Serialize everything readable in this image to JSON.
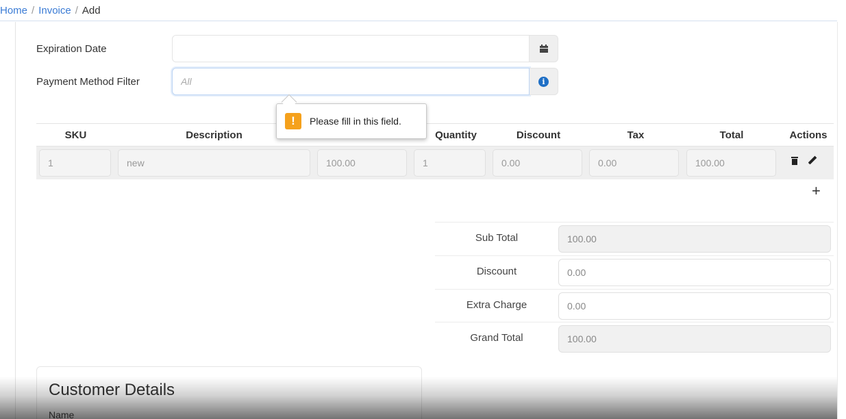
{
  "breadcrumb": {
    "home": "Home",
    "sep": "/",
    "invoice": "Invoice",
    "current": "Add"
  },
  "form": {
    "expiration_label": "Expiration Date",
    "expiration_value": "",
    "payment_label": "Payment Method Filter",
    "payment_placeholder": "All"
  },
  "tooltip": {
    "icon": "!",
    "message": "Please fill in this field."
  },
  "table": {
    "headers": [
      "SKU",
      "Description",
      "Quantity",
      "Discount",
      "Tax",
      "Total",
      "Actions"
    ],
    "rows": [
      {
        "sku": "1",
        "description": "new",
        "price": "100.00",
        "quantity": "1",
        "discount": "0.00",
        "tax": "0.00",
        "total": "100.00"
      }
    ]
  },
  "totals": {
    "sub_total_label": "Sub Total",
    "sub_total": "100.00",
    "discount_label": "Discount",
    "discount": "0.00",
    "extra_charge_label": "Extra Charge",
    "extra_charge": "0.00",
    "grand_total_label": "Grand Total",
    "grand_total": "100.00"
  },
  "customer": {
    "title": "Customer Details",
    "name_label": "Name"
  },
  "icons": {
    "calendar": "calendar-icon",
    "info": "info-icon",
    "warning": "warning-icon",
    "trash": "trash-icon",
    "edit": "pencil-icon",
    "add": "plus-icon"
  },
  "colors": {
    "link": "#3a7bd5",
    "info": "#1f6fc5",
    "warning": "#f5a11c"
  }
}
